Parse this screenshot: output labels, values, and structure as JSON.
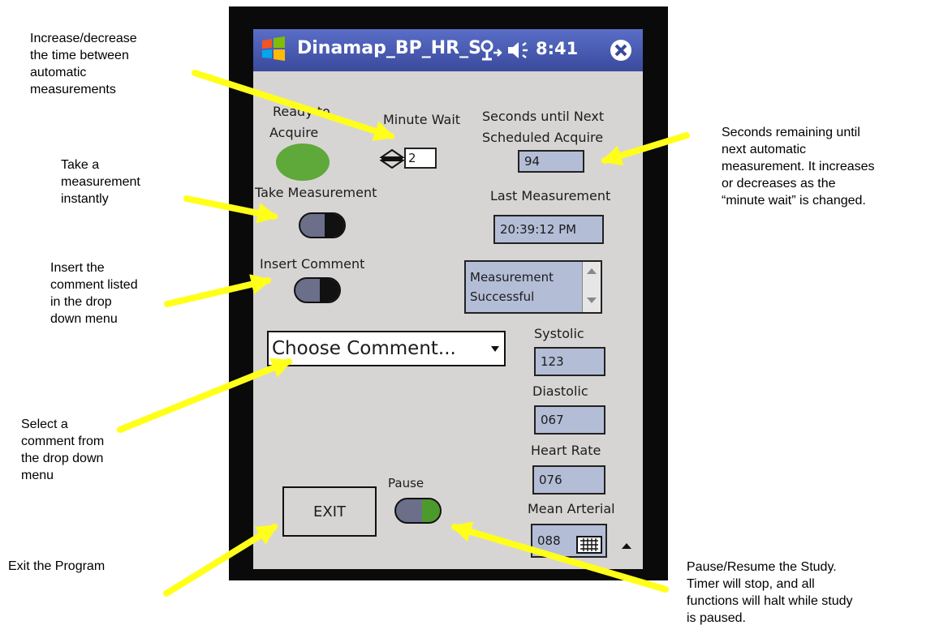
{
  "annotations": {
    "minute_wait": [
      "Increase/decrease",
      "the time between",
      "automatic",
      "measurements"
    ],
    "take_measurement": [
      "Take a",
      "measurement",
      "instantly"
    ],
    "insert_comment": [
      "Insert the",
      "comment listed",
      "in the drop",
      "down menu"
    ],
    "select_comment": [
      "Select a",
      "comment from",
      "the drop down",
      "menu"
    ],
    "exit": "Exit the Program",
    "seconds_remaining": [
      "Seconds remaining until",
      "next automatic",
      "measurement. It increases",
      "or decreases as the",
      "“minute wait” is changed."
    ],
    "pause": [
      "Pause/Resume the Study.",
      "Timer will stop, and all",
      "functions will halt while study",
      "is paused."
    ]
  },
  "app": {
    "title": "Dinamap_BP_HR_S",
    "time": "8:41",
    "ready_label_1": "Ready to",
    "ready_label_2": "Acquire",
    "minute_wait_label": "Minute Wait",
    "minute_wait_value": "2",
    "seconds_label_1": "Seconds until Next",
    "seconds_label_2": "Scheduled Acquire",
    "seconds_value": "94",
    "take_measurement_label": "Take Measurement",
    "last_measurement_label": "Last Measurement",
    "last_measurement_value": "20:39:12 PM",
    "insert_comment_label": "Insert Comment",
    "status_lines": [
      "Measurement",
      "Successful"
    ],
    "comment_dropdown": "Choose Comment...",
    "systolic_label": "Systolic",
    "systolic_value": "123",
    "diastolic_label": "Diastolic",
    "diastolic_value": "067",
    "heart_rate_label": "Heart Rate",
    "heart_rate_value": "076",
    "mean_arterial_label": "Mean Arterial",
    "mean_arterial_value": "088",
    "pause_label": "Pause",
    "exit_label": "EXIT"
  },
  "colors": {
    "arrow": "#ffff1a",
    "ready_indicator": "#5fa83a",
    "screen_background": "#d7d5d3",
    "field_fill": "#b3bdd6",
    "title_bar": "#3f51a8"
  },
  "icons": [
    "windows-start-icon",
    "signal-icon",
    "speaker-icon",
    "close-icon",
    "up-down-stepper-icon",
    "keyboard-icon"
  ]
}
